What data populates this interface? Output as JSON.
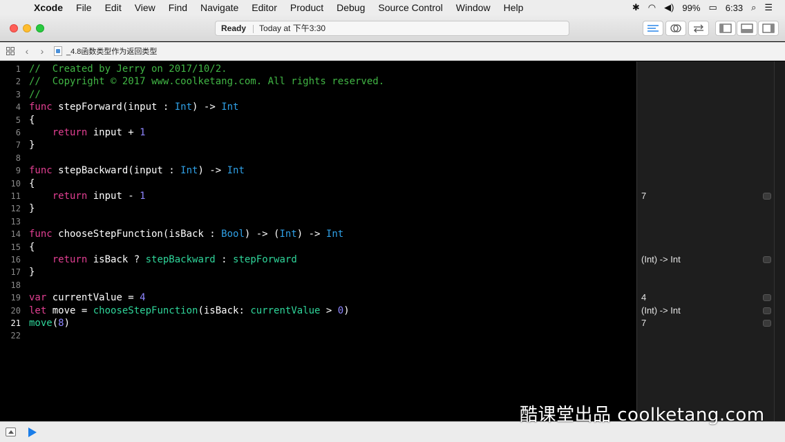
{
  "menubar": {
    "items": [
      "Xcode",
      "File",
      "Edit",
      "View",
      "Find",
      "Navigate",
      "Editor",
      "Product",
      "Debug",
      "Source Control",
      "Window",
      "Help"
    ],
    "battery": "99%",
    "time": "6:33"
  },
  "toolbar": {
    "status": "Ready",
    "timestamp": "Today at 下午3:30"
  },
  "jumpbar": {
    "filename": "_4.8函数类型作为返回类型"
  },
  "editor": {
    "current_line": 21,
    "lines": [
      {
        "n": "1",
        "segs": [
          [
            "c-comment",
            "//  Created by Jerry on 2017/10/2."
          ]
        ]
      },
      {
        "n": "2",
        "segs": [
          [
            "c-comment",
            "//  Copyright © 2017 www.coolketang.com. All rights reserved."
          ]
        ]
      },
      {
        "n": "3",
        "segs": [
          [
            "c-comment",
            "//"
          ]
        ]
      },
      {
        "n": "4",
        "segs": [
          [
            "c-kw",
            "func"
          ],
          [
            "",
            " stepForward(input : "
          ],
          [
            "c-type",
            "Int"
          ],
          [
            "",
            ") -> "
          ],
          [
            "c-type",
            "Int"
          ]
        ]
      },
      {
        "n": "5",
        "segs": [
          [
            "",
            "{"
          ]
        ]
      },
      {
        "n": "6",
        "segs": [
          [
            "",
            "    "
          ],
          [
            "c-kw",
            "return"
          ],
          [
            "",
            " input + "
          ],
          [
            "c-num",
            "1"
          ]
        ]
      },
      {
        "n": "7",
        "segs": [
          [
            "",
            "}"
          ]
        ]
      },
      {
        "n": "8",
        "segs": []
      },
      {
        "n": "9",
        "segs": [
          [
            "c-kw",
            "func"
          ],
          [
            "",
            " stepBackward(input : "
          ],
          [
            "c-type",
            "Int"
          ],
          [
            "",
            ") -> "
          ],
          [
            "c-type",
            "Int"
          ]
        ]
      },
      {
        "n": "10",
        "segs": [
          [
            "",
            "{"
          ]
        ]
      },
      {
        "n": "11",
        "segs": [
          [
            "",
            "    "
          ],
          [
            "c-kw",
            "return"
          ],
          [
            "",
            " input - "
          ],
          [
            "c-num",
            "1"
          ]
        ]
      },
      {
        "n": "12",
        "segs": [
          [
            "",
            "}"
          ]
        ]
      },
      {
        "n": "13",
        "segs": []
      },
      {
        "n": "14",
        "segs": [
          [
            "c-kw",
            "func"
          ],
          [
            "",
            " chooseStepFunction(isBack : "
          ],
          [
            "c-type",
            "Bool"
          ],
          [
            "",
            ") -> ("
          ],
          [
            "c-type",
            "Int"
          ],
          [
            "",
            ") -> "
          ],
          [
            "c-type",
            "Int"
          ]
        ]
      },
      {
        "n": "15",
        "segs": [
          [
            "",
            "{"
          ]
        ]
      },
      {
        "n": "16",
        "segs": [
          [
            "",
            "    "
          ],
          [
            "c-kw",
            "return"
          ],
          [
            "",
            " isBack ? "
          ],
          [
            "c-fn",
            "stepBackward"
          ],
          [
            "",
            " : "
          ],
          [
            "c-fn",
            "stepForward"
          ]
        ]
      },
      {
        "n": "17",
        "segs": [
          [
            "",
            "}"
          ]
        ]
      },
      {
        "n": "18",
        "segs": []
      },
      {
        "n": "19",
        "segs": [
          [
            "c-kw",
            "var"
          ],
          [
            "",
            " currentValue = "
          ],
          [
            "c-num",
            "4"
          ]
        ]
      },
      {
        "n": "20",
        "segs": [
          [
            "c-kw",
            "let"
          ],
          [
            "",
            " move = "
          ],
          [
            "c-fn",
            "chooseStepFunction"
          ],
          [
            "",
            "(isBack: "
          ],
          [
            "c-fn",
            "currentValue"
          ],
          [
            "",
            " > "
          ],
          [
            "c-num",
            "0"
          ],
          [
            "",
            ")"
          ]
        ]
      },
      {
        "n": "21",
        "segs": [
          [
            "c-fn",
            "move"
          ],
          [
            "",
            "("
          ],
          [
            "c-num",
            "8"
          ],
          [
            "",
            ")"
          ]
        ]
      },
      {
        "n": "22",
        "segs": []
      }
    ]
  },
  "results": [
    {
      "line": 11,
      "text": "7"
    },
    {
      "line": 16,
      "text": "(Int) -> Int"
    },
    {
      "line": 19,
      "text": "4"
    },
    {
      "line": 20,
      "text": "(Int) -> Int"
    },
    {
      "line": 21,
      "text": "7"
    }
  ],
  "watermark": "酷课堂出品 coolketang.com"
}
